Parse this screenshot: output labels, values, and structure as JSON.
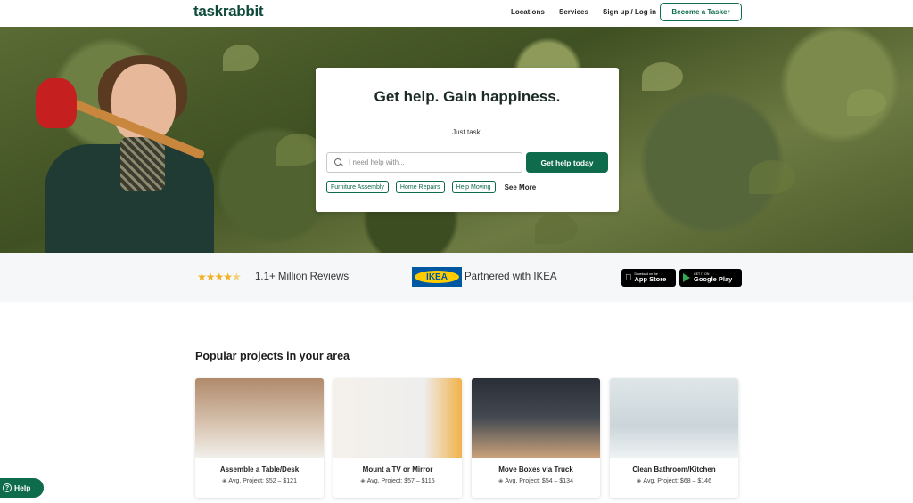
{
  "header": {
    "logo": "taskrabbit",
    "nav": [
      "Locations",
      "Services",
      "Sign up / Log in"
    ],
    "become_tasker": "Become a Tasker"
  },
  "hero": {
    "title": "Get help. Gain happiness.",
    "subtitle": "Just task.",
    "search_placeholder": "I need help with...",
    "cta_label": "Get help today",
    "chips": [
      "Furniture Assembly",
      "Home Repairs",
      "Help Moving"
    ],
    "see_more": "See More"
  },
  "trust": {
    "rating_stars": 4.5,
    "reviews_text": "1.1+ Million Reviews",
    "ikea_logo_text": "IKEA",
    "ikea_text": "Partnered with IKEA",
    "app_store_small": "Download on the",
    "app_store_big": "App Store",
    "google_play_small": "GET IT ON",
    "google_play_big": "Google Play"
  },
  "popular": {
    "title": "Popular projects in your area",
    "cards": [
      {
        "title": "Assemble a Table/Desk",
        "price": "Avg. Project: $52 – $121"
      },
      {
        "title": "Mount a TV or Mirror",
        "price": "Avg. Project: $57 – $115"
      },
      {
        "title": "Move Boxes via Truck",
        "price": "Avg. Project: $54 – $134"
      },
      {
        "title": "Clean Bathroom/Kitchen",
        "price": "Avg. Project: $68 – $146"
      }
    ]
  },
  "help_button": "Help",
  "colors": {
    "brand_green": "#0e6b4b",
    "logo_green": "#0e4a3a",
    "star_yellow": "#f2b01e",
    "ikea_blue": "#0058a3",
    "ikea_yellow": "#ffcc00"
  }
}
